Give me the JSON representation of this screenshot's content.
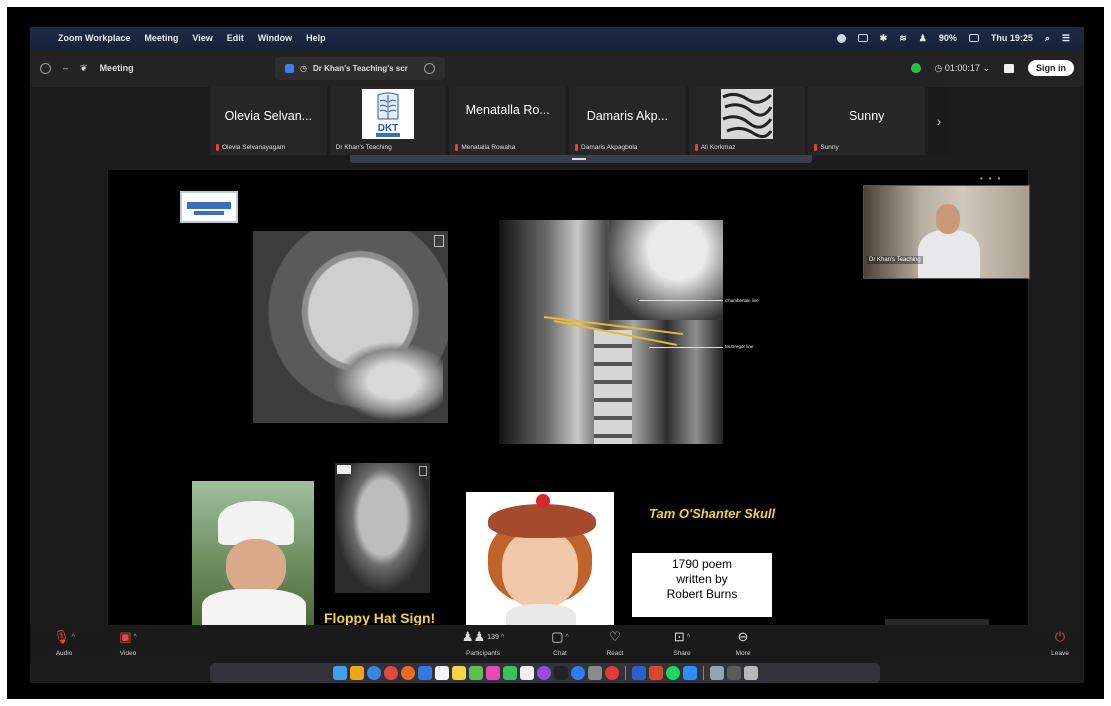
{
  "menubar": {
    "app": "Zoom Workplace",
    "menus": [
      "Meeting",
      "View",
      "Edit",
      "Window",
      "Help"
    ],
    "battery": "90%",
    "clock": "Thu 19:25"
  },
  "titlebar": {
    "meeting_label": "Meeting",
    "tab_title": "Dr Khan's Teaching's scr",
    "timer": "01:00:17",
    "signin": "Sign in"
  },
  "participants": [
    {
      "display": "Olevia Selvan...",
      "name": "Olevia Selvanayagam",
      "type": "name"
    },
    {
      "display": "",
      "name": "Dr Khan's Teaching",
      "type": "logo",
      "logo_text": "DKT"
    },
    {
      "display": "Menatalla Ro...",
      "name": "Menatalla Rowaha",
      "type": "name"
    },
    {
      "display": "Damaris Akp...",
      "name": "Damaris Akpagbola",
      "type": "name"
    },
    {
      "display": "",
      "name": "Ali Korkmaz",
      "type": "image"
    },
    {
      "display": "Sunny",
      "name": "Sunny",
      "type": "name"
    }
  ],
  "slide": {
    "mri_annotations": [
      "Chamberlain line",
      "McGregor line"
    ],
    "floppy_caption": "Floppy Hat Sign!",
    "tam_caption": "Tam O'Shanter Skull",
    "poem_lines": [
      "1790 poem",
      "written by",
      "Robert Burns"
    ]
  },
  "video": {
    "label": "Dr Khan's Teaching"
  },
  "toolbar": {
    "audio": "Audio",
    "video": "Video",
    "participants": "Participants",
    "participants_count": "139",
    "chat": "Chat",
    "react": "React",
    "share": "Share",
    "more": "More",
    "leave": "Leave"
  }
}
